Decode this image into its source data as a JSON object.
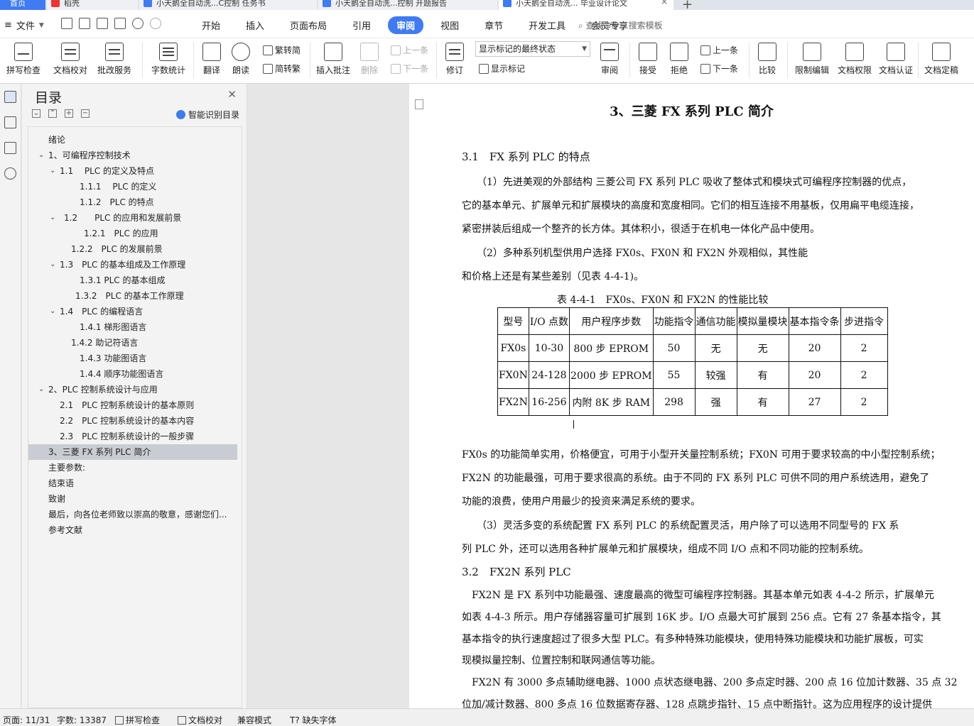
{
  "tabs": [
    {
      "label": "首页"
    },
    {
      "label": "稻壳"
    },
    {
      "label": "小天鹅全自动洗...C控制 任务书"
    },
    {
      "label": "小天鹅全自动洗...控制 开题报告"
    },
    {
      "label": "小天鹅全自动洗... 毕业设计论文"
    }
  ],
  "menu": {
    "file": "文件",
    "tabs": [
      "开始",
      "插入",
      "页面布局",
      "引用",
      "审阅",
      "视图",
      "章节",
      "开发工具",
      "会员专享"
    ],
    "active": "审阅",
    "search": "查找命令、搜索模板"
  },
  "ribbon": {
    "spellcheck": "拼写检查",
    "doc_check": "文档校对",
    "review_service": "批改服务",
    "word_count": "字数统计",
    "translate": "翻译",
    "read_aloud": "朗读",
    "trad_to_simp": "繁转简",
    "simp_to_trad": "简转繁",
    "insert_comment": "插入批注",
    "delete": "删除",
    "prev": "上一条",
    "next": "下一条",
    "track": "修订",
    "markup_select": "显示标记的最终状态",
    "show_markup": "显示标记",
    "review": "审阅",
    "accept": "接受",
    "reject": "拒绝",
    "prev2": "上一条",
    "next2": "下一条",
    "compare": "比较",
    "restrict": "限制编辑",
    "doc_rights": "文档权限",
    "doc_auth": "文档认证",
    "doc_final": "文档定稿"
  },
  "toc": {
    "title": "目录",
    "smart": "智能识别目录",
    "items": [
      {
        "label": "绪论"
      },
      {
        "label": "1、可编程序控制技术"
      },
      {
        "label": "1.1　 PLC 的定义及特点"
      },
      {
        "label": "1.1.1　 PLC 的定义"
      },
      {
        "label": "1.1.2　PLC 的特点"
      },
      {
        "label": "1.2　　PLC 的应用和发展前景"
      },
      {
        "label": "1.2.1　PLC 的应用"
      },
      {
        "label": "1.2.2　PLC 的发展前景"
      },
      {
        "label": "1.3　PLC 的基本组成及工作原理"
      },
      {
        "label": "1.3.1 PLC 的基本组成"
      },
      {
        "label": "1.3.2　PLC 的基本工作原理"
      },
      {
        "label": "1.4　PLC 的编程语言"
      },
      {
        "label": "1.4.1 梯形图语言"
      },
      {
        "label": "1.4.2 助记符语言"
      },
      {
        "label": "1.4.3 功能图语言"
      },
      {
        "label": "1.4.4 顺序功能图语言"
      },
      {
        "label": "2、PLC 控制系统设计与应用"
      },
      {
        "label": "2.1　PLC 控制系统设计的基本原则"
      },
      {
        "label": "2.2　PLC 控制系统设计的基本内容"
      },
      {
        "label": "2.3　PLC 控制系统设计的一般步骤"
      },
      {
        "label": "3、三菱 FX 系列 PLC 简介"
      },
      {
        "label": "主要参数:"
      },
      {
        "label": "结束语"
      },
      {
        "label": "致谢"
      },
      {
        "label": "最后，向各位老师致以崇高的敬意，感谢您们..."
      },
      {
        "label": "参考文献"
      }
    ]
  },
  "doc": {
    "title": "3、三菱 FX 系列 PLC 简介",
    "h31": "3.1　FX 系列 PLC 的特点",
    "p1": [
      "　　（1）先进美观的外部结构  三菱公司 FX 系列 PLC 吸收了整体式和模块式可编程序控制器的优点，",
      "它的基本单元、扩展单元和扩展模块的高度和宽度相同。它们的相互连接不用基板，仅用扁平电缆连接，",
      "紧密拼装后组成一个整齐的长方体。其体积小，很适于在机电一体化产品中使用。",
      "　　（2）多种系列机型供用户选择    FX0s、FX0N 和 FX2N 外观相似，其性能",
      "和价格上还是有某些差别（见表 4-4-1)。"
    ],
    "table_caption": "表 4-4-1　FX0s、FX0N 和 FX2N 的性能比较",
    "table_header": [
      "型号",
      "I/O 点数",
      "用户程序步数",
      "功能指令",
      "通信功能",
      "模拟量模块",
      "基本指令条",
      "步进指令"
    ],
    "table_rows": [
      [
        "FX0s",
        "10-30",
        "800 步 EPROM",
        "50",
        "无",
        "无",
        "20",
        "2"
      ],
      [
        "FX0N",
        "24-128",
        "2000 步 EPROM",
        "55",
        "较强",
        "有",
        "20",
        "2"
      ],
      [
        "FX2N",
        "16-256",
        "内附 8K 步 RAM",
        "298",
        "强",
        "有",
        "27",
        "2"
      ]
    ],
    "p2": [
      "FX0s 的功能简单实用，价格便宜，可用于小型开关量控制系统；FX0N 可用于要求较高的中小型控制系统；",
      "FX2N 的功能最强，可用于要求很高的系统。由于不同的 FX 系列 PLC 可供不同的用户系统选用，避免了",
      "功能的浪费，使用户用最少的投资来满足系统的要求。",
      "　　（3）灵活多变的系统配置    FX 系列 PLC 的系统配置灵活，用户除了可以选用不同型号的 FX 系",
      "列 PLC 外，还可以选用各种扩展单元和扩展模块，组成不同 I/O 点和不同功能的控制系统。"
    ],
    "h32": "3.2　FX2N 系列 PLC",
    "p3": [
      "　FX2N 是 FX 系列中功能最强、速度最高的微型可编程序控制器。其基本单元如表 4-4-2 所示，扩展单元",
      "如表 4-4-3 所示。用户存储器容量可扩展到 16K 步。I/O 点最大可扩展到 256 点。它有 27 条基本指令，其",
      "基本指令的执行速度超过了很多大型 PLC。有多种特殊功能模块，使用特殊功能模块和功能扩展板，可实",
      "现模拟量控制、位置控制和联网通信等功能。",
      "　FX2N 有 3000 多点辅助继电器、1000 点状态继电器、200 多点定时器、200 点 16 位加计数器、35 点 32",
      "位加/减计数器、800 多点 16 位数据寄存器、128 点跳步指针、15 点中断指针。这为应用程序的设计提供"
    ]
  },
  "status": {
    "page": "页面: 11/31",
    "words": "字数: 13387",
    "spell": "拼写检查",
    "doccheck": "文档校对",
    "compat": "兼容模式",
    "missing_font": "缺失字体"
  }
}
